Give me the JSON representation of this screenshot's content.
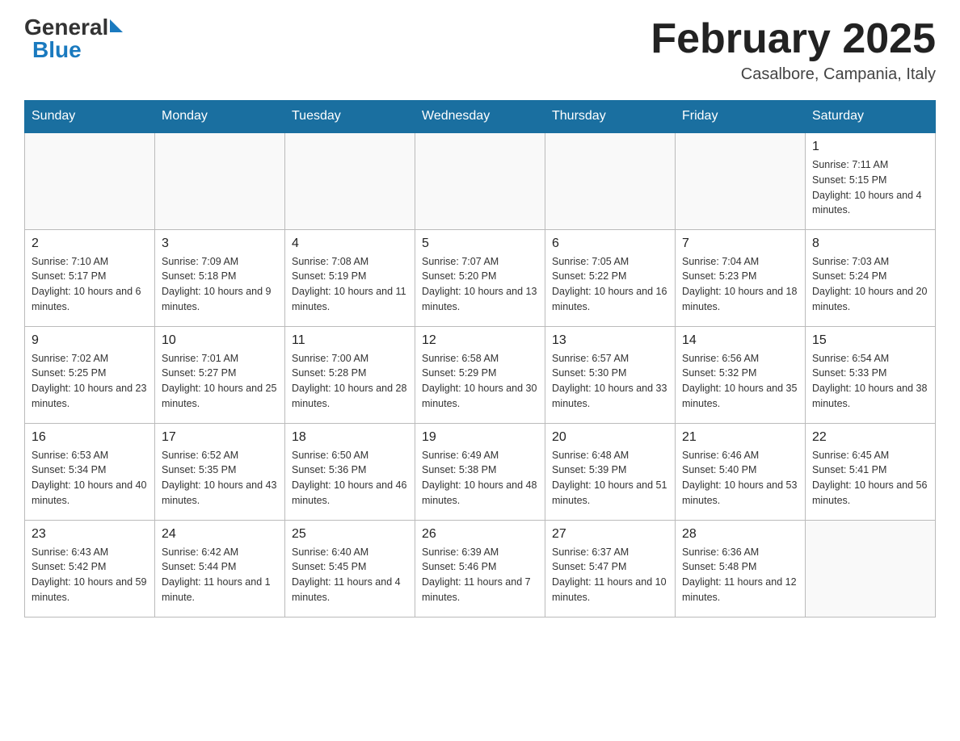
{
  "header": {
    "logo_general": "General",
    "logo_blue": "Blue",
    "month": "February 2025",
    "location": "Casalbore, Campania, Italy"
  },
  "weekdays": [
    "Sunday",
    "Monday",
    "Tuesday",
    "Wednesday",
    "Thursday",
    "Friday",
    "Saturday"
  ],
  "weeks": [
    [
      {
        "day": "",
        "info": ""
      },
      {
        "day": "",
        "info": ""
      },
      {
        "day": "",
        "info": ""
      },
      {
        "day": "",
        "info": ""
      },
      {
        "day": "",
        "info": ""
      },
      {
        "day": "",
        "info": ""
      },
      {
        "day": "1",
        "info": "Sunrise: 7:11 AM\nSunset: 5:15 PM\nDaylight: 10 hours and 4 minutes."
      }
    ],
    [
      {
        "day": "2",
        "info": "Sunrise: 7:10 AM\nSunset: 5:17 PM\nDaylight: 10 hours and 6 minutes."
      },
      {
        "day": "3",
        "info": "Sunrise: 7:09 AM\nSunset: 5:18 PM\nDaylight: 10 hours and 9 minutes."
      },
      {
        "day": "4",
        "info": "Sunrise: 7:08 AM\nSunset: 5:19 PM\nDaylight: 10 hours and 11 minutes."
      },
      {
        "day": "5",
        "info": "Sunrise: 7:07 AM\nSunset: 5:20 PM\nDaylight: 10 hours and 13 minutes."
      },
      {
        "day": "6",
        "info": "Sunrise: 7:05 AM\nSunset: 5:22 PM\nDaylight: 10 hours and 16 minutes."
      },
      {
        "day": "7",
        "info": "Sunrise: 7:04 AM\nSunset: 5:23 PM\nDaylight: 10 hours and 18 minutes."
      },
      {
        "day": "8",
        "info": "Sunrise: 7:03 AM\nSunset: 5:24 PM\nDaylight: 10 hours and 20 minutes."
      }
    ],
    [
      {
        "day": "9",
        "info": "Sunrise: 7:02 AM\nSunset: 5:25 PM\nDaylight: 10 hours and 23 minutes."
      },
      {
        "day": "10",
        "info": "Sunrise: 7:01 AM\nSunset: 5:27 PM\nDaylight: 10 hours and 25 minutes."
      },
      {
        "day": "11",
        "info": "Sunrise: 7:00 AM\nSunset: 5:28 PM\nDaylight: 10 hours and 28 minutes."
      },
      {
        "day": "12",
        "info": "Sunrise: 6:58 AM\nSunset: 5:29 PM\nDaylight: 10 hours and 30 minutes."
      },
      {
        "day": "13",
        "info": "Sunrise: 6:57 AM\nSunset: 5:30 PM\nDaylight: 10 hours and 33 minutes."
      },
      {
        "day": "14",
        "info": "Sunrise: 6:56 AM\nSunset: 5:32 PM\nDaylight: 10 hours and 35 minutes."
      },
      {
        "day": "15",
        "info": "Sunrise: 6:54 AM\nSunset: 5:33 PM\nDaylight: 10 hours and 38 minutes."
      }
    ],
    [
      {
        "day": "16",
        "info": "Sunrise: 6:53 AM\nSunset: 5:34 PM\nDaylight: 10 hours and 40 minutes."
      },
      {
        "day": "17",
        "info": "Sunrise: 6:52 AM\nSunset: 5:35 PM\nDaylight: 10 hours and 43 minutes."
      },
      {
        "day": "18",
        "info": "Sunrise: 6:50 AM\nSunset: 5:36 PM\nDaylight: 10 hours and 46 minutes."
      },
      {
        "day": "19",
        "info": "Sunrise: 6:49 AM\nSunset: 5:38 PM\nDaylight: 10 hours and 48 minutes."
      },
      {
        "day": "20",
        "info": "Sunrise: 6:48 AM\nSunset: 5:39 PM\nDaylight: 10 hours and 51 minutes."
      },
      {
        "day": "21",
        "info": "Sunrise: 6:46 AM\nSunset: 5:40 PM\nDaylight: 10 hours and 53 minutes."
      },
      {
        "day": "22",
        "info": "Sunrise: 6:45 AM\nSunset: 5:41 PM\nDaylight: 10 hours and 56 minutes."
      }
    ],
    [
      {
        "day": "23",
        "info": "Sunrise: 6:43 AM\nSunset: 5:42 PM\nDaylight: 10 hours and 59 minutes."
      },
      {
        "day": "24",
        "info": "Sunrise: 6:42 AM\nSunset: 5:44 PM\nDaylight: 11 hours and 1 minute."
      },
      {
        "day": "25",
        "info": "Sunrise: 6:40 AM\nSunset: 5:45 PM\nDaylight: 11 hours and 4 minutes."
      },
      {
        "day": "26",
        "info": "Sunrise: 6:39 AM\nSunset: 5:46 PM\nDaylight: 11 hours and 7 minutes."
      },
      {
        "day": "27",
        "info": "Sunrise: 6:37 AM\nSunset: 5:47 PM\nDaylight: 11 hours and 10 minutes."
      },
      {
        "day": "28",
        "info": "Sunrise: 6:36 AM\nSunset: 5:48 PM\nDaylight: 11 hours and 12 minutes."
      },
      {
        "day": "",
        "info": ""
      }
    ]
  ]
}
